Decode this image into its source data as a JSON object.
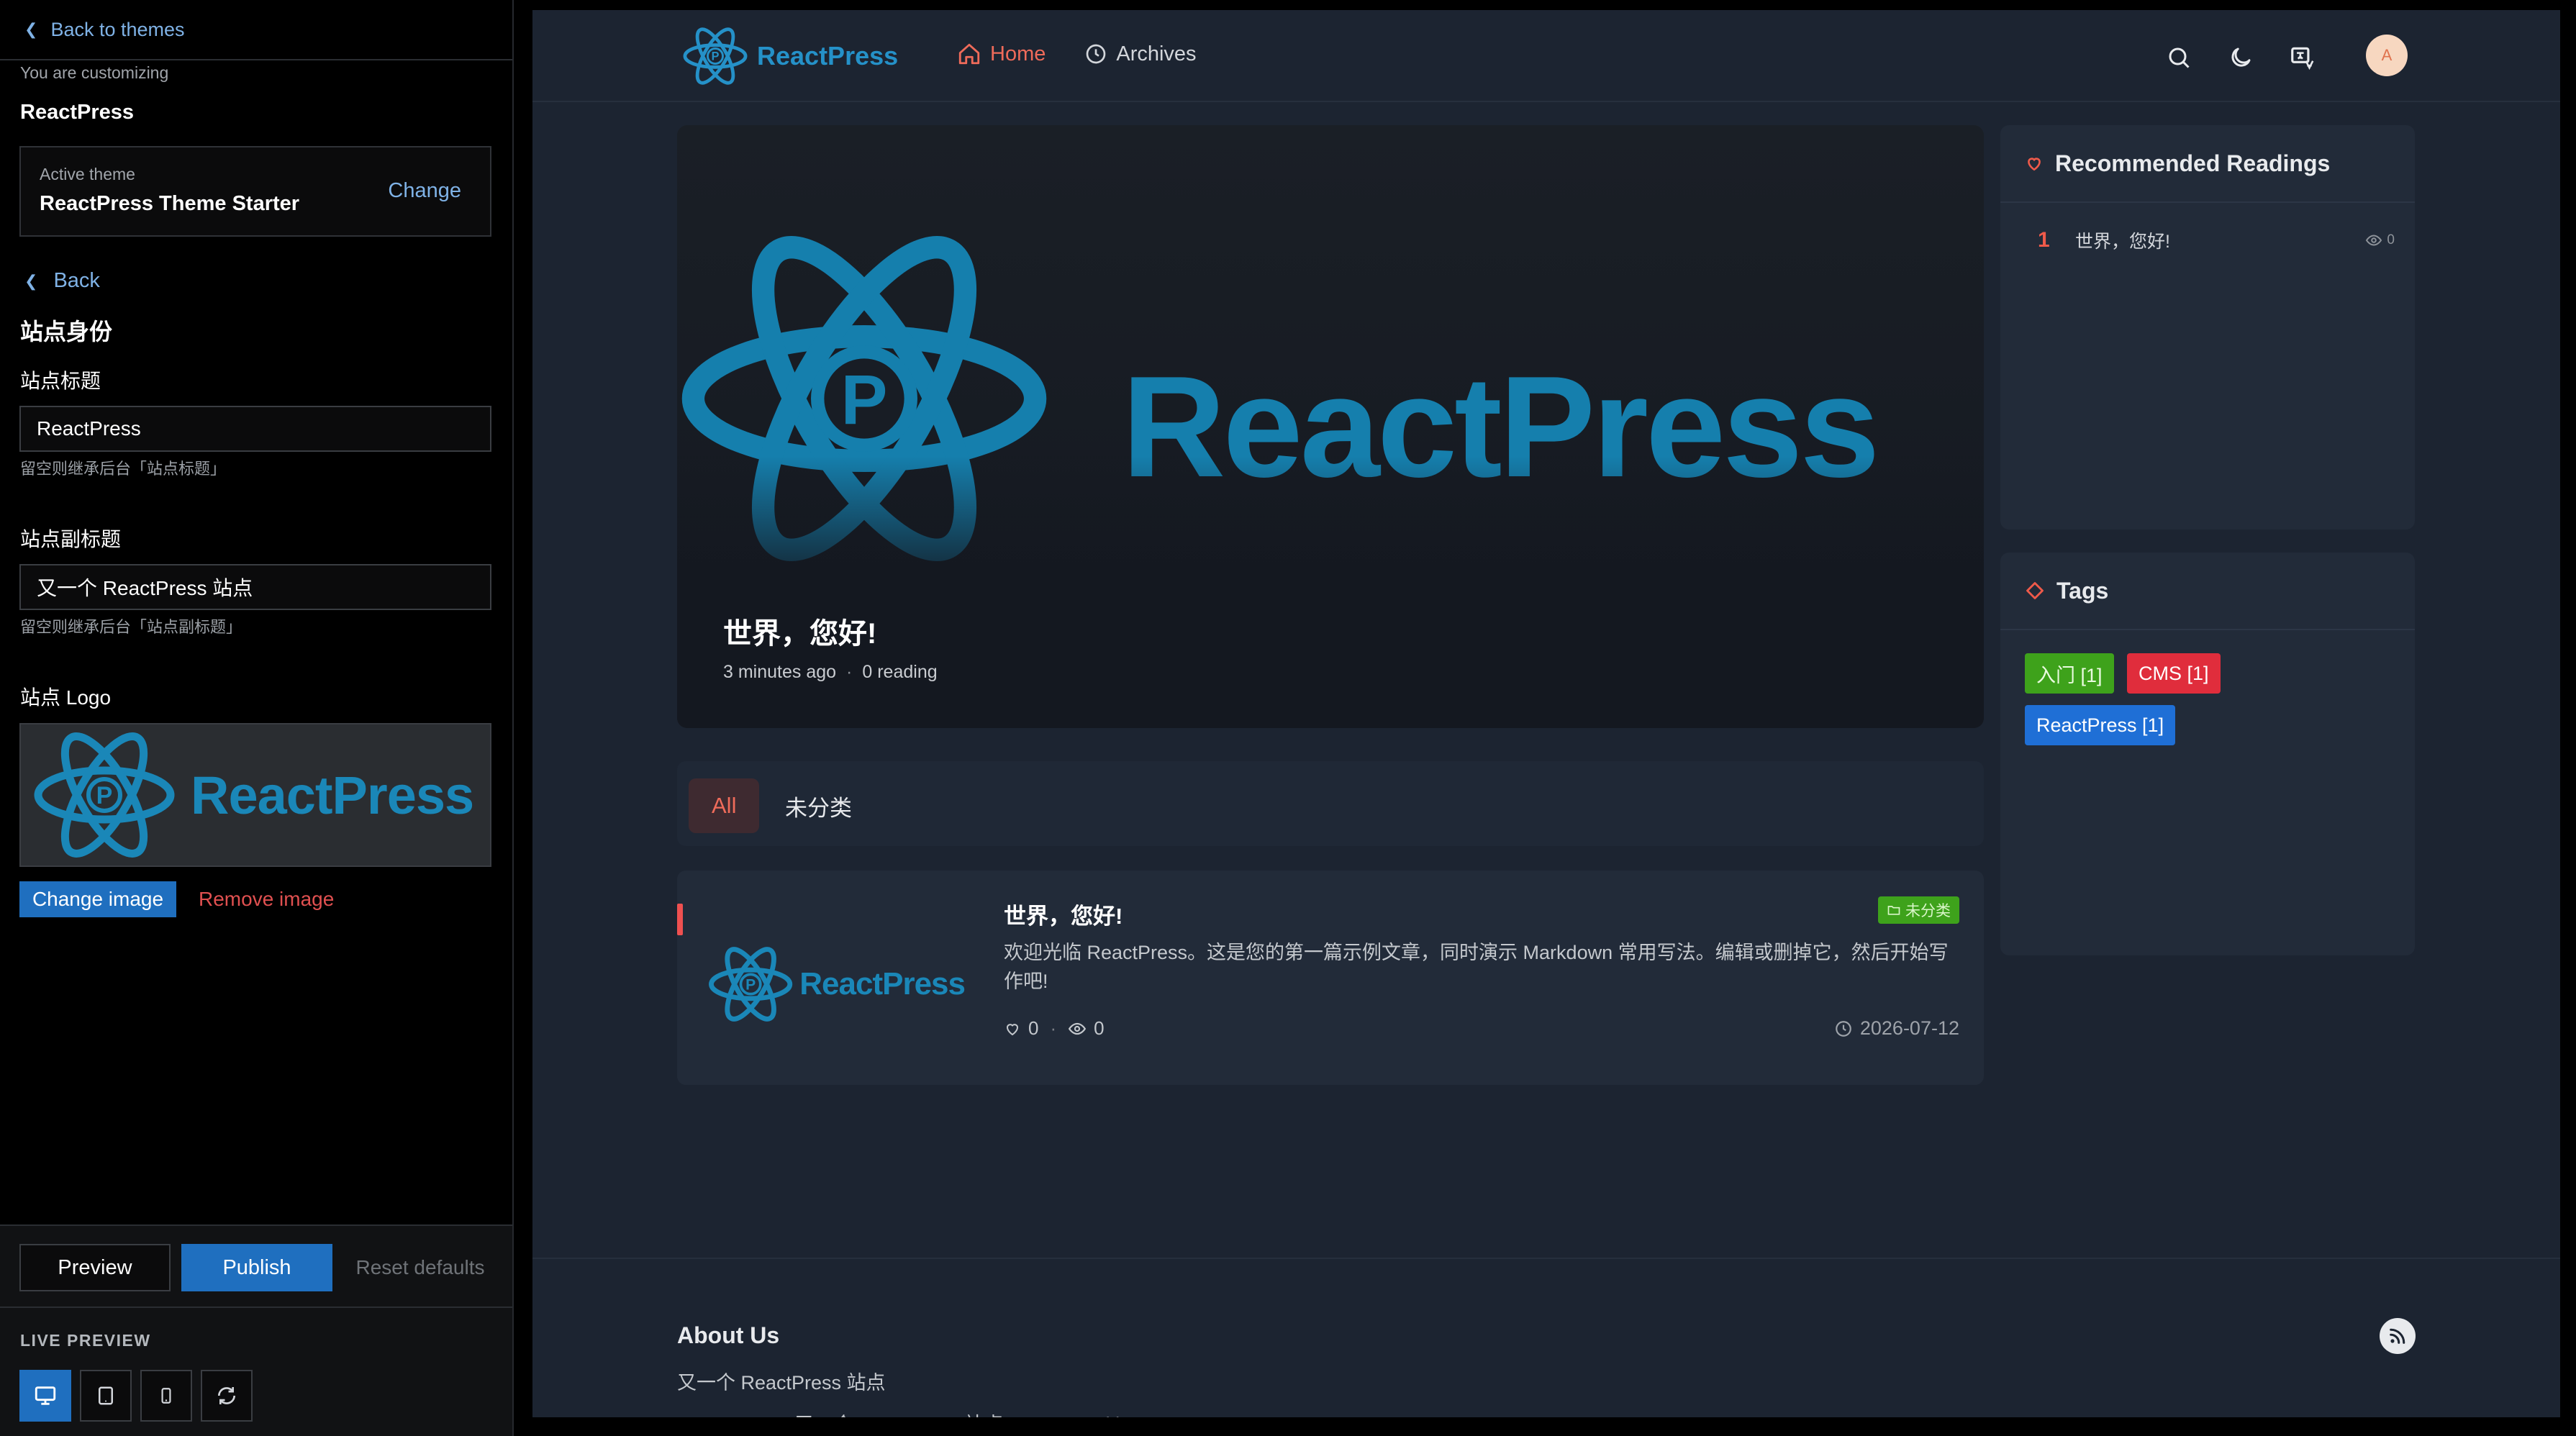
{
  "customizer": {
    "back_to_themes": "Back to themes",
    "customizing_label": "You are customizing",
    "theme_name": "ReactPress",
    "active_theme_label": "Active theme",
    "active_theme_value": "ReactPress Theme Starter",
    "change_label": "Change",
    "back_label": "Back",
    "section_title": "站点身份",
    "site_title_label": "站点标题",
    "site_title_value": "ReactPress",
    "site_title_hint": "留空则继承后台「站点标题」",
    "site_subtitle_label": "站点副标题",
    "site_subtitle_value": "又一个 ReactPress 站点",
    "site_subtitle_hint": "留空则继承后台「站点副标题」",
    "logo_label": "站点 Logo",
    "logo_wordmark": "ReactPress",
    "change_image": "Change image",
    "remove_image": "Remove image",
    "preview_btn": "Preview",
    "publish_btn": "Publish",
    "reset_btn": "Reset defaults",
    "live_preview_label": "LIVE PREVIEW",
    "devices": [
      {
        "name": "desktop",
        "icon": "desktop-icon",
        "active": true
      },
      {
        "name": "tablet",
        "icon": "tablet-icon",
        "active": false
      },
      {
        "name": "mobile",
        "icon": "mobile-icon",
        "active": false
      },
      {
        "name": "refresh",
        "icon": "refresh-icon",
        "active": false
      }
    ]
  },
  "site": {
    "brand": "ReactPress",
    "nav": [
      {
        "label": "Home",
        "icon": "home-icon",
        "active": true
      },
      {
        "label": "Archives",
        "icon": "clock-icon",
        "active": false
      }
    ],
    "header_icons": [
      "search-icon",
      "moon-icon",
      "language-icon"
    ],
    "avatar_letter": "A",
    "hero": {
      "wordmark": "ReactPress",
      "title": "世界，您好!",
      "time": "3 minutes ago",
      "reading": "0 reading"
    },
    "tabs": [
      "All",
      "未分类"
    ],
    "post": {
      "title": "世界，您好!",
      "excerpt": "欢迎光临 ReactPress。这是您的第一篇示例文章，同时演示 Markdown 常用写法。编辑或删掉它，然后开始写作吧!",
      "category": "未分类",
      "likes": "0",
      "views": "0",
      "date": "2026-07-12",
      "thumb_wordmark": "ReactPress"
    },
    "recommended": {
      "title": "Recommended Readings",
      "items": [
        {
          "rank": "1",
          "title": "世界，您好!",
          "views": "0"
        }
      ]
    },
    "tags": {
      "title": "Tags",
      "items": [
        {
          "label": "入门 [1]",
          "color": "#3ea21b"
        },
        {
          "label": "CMS [1]",
          "color": "#e02d3c"
        },
        {
          "label": "ReactPress [1]",
          "color": "#1f6fd6"
        }
      ]
    },
    "footer": {
      "title": "About Us",
      "subtitle": "又一个 ReactPress 站点",
      "copyright": "ReactPress - 又一个 ReactPress 站点 — Powered by ReactPress"
    }
  },
  "colors": {
    "accent": "#ef6b5a",
    "brand_blue": "#1a87b8",
    "link_blue": "#7fb2e6",
    "primary_button": "#1f6fbf"
  }
}
